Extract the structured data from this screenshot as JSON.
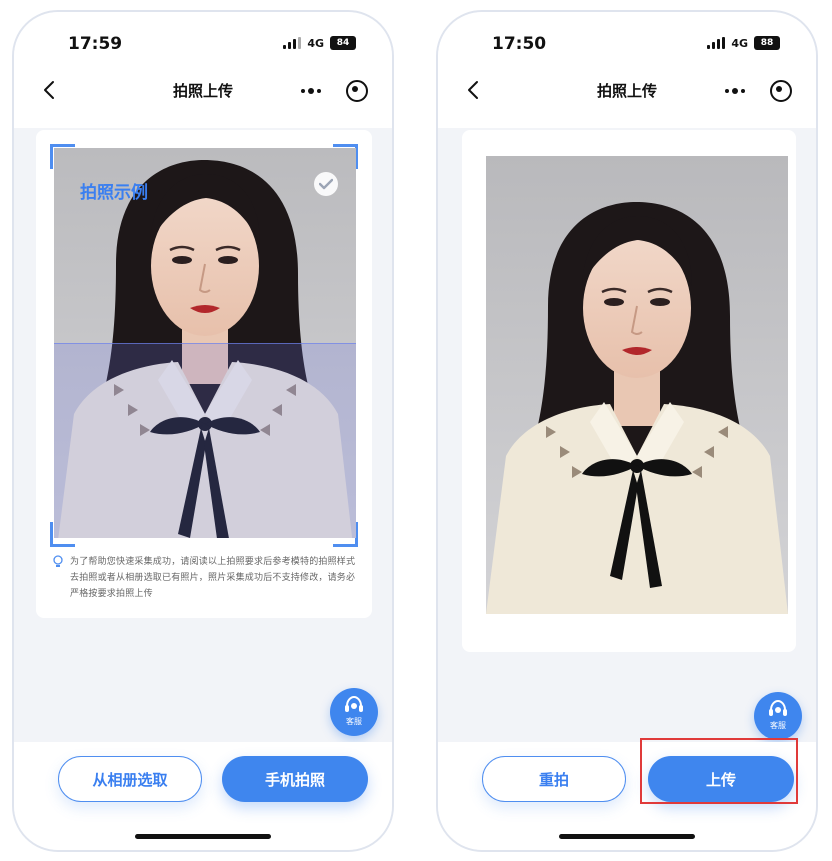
{
  "left_phone": {
    "status": {
      "time": "17:59",
      "network": "4G",
      "battery": "84"
    },
    "nav": {
      "title": "拍照上传"
    },
    "example_label": "拍照示例",
    "tip": "为了帮助您快速采集成功，请阅读以上拍照要求后参考模特的拍照样式去拍照或者从相册选取已有照片，照片采集成功后不支持修改，请务必严格按要求拍照上传",
    "service_label": "客服",
    "buttons": {
      "album": "从相册选取",
      "camera": "手机拍照"
    }
  },
  "right_phone": {
    "status": {
      "time": "17:50",
      "network": "4G",
      "battery": "88"
    },
    "nav": {
      "title": "拍照上传"
    },
    "service_label": "客服",
    "buttons": {
      "retake": "重拍",
      "upload": "上传"
    }
  },
  "colors": {
    "primary": "#3f86ee",
    "highlight": "#e03a3a"
  }
}
